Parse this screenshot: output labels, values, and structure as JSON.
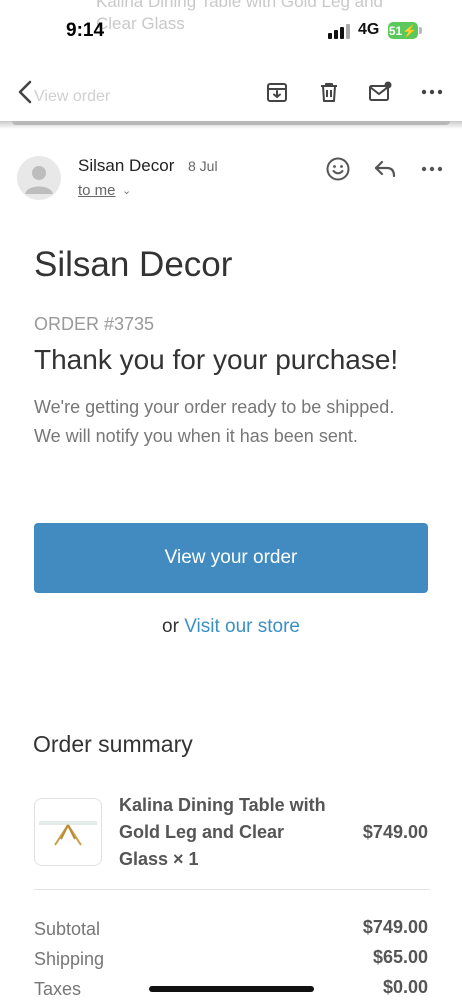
{
  "status_bar": {
    "time": "9:14",
    "network": "4G",
    "battery": "51"
  },
  "background_subject": {
    "line1": "Kalina Dining Table with Gold Leg and",
    "line2": "Clear Glass"
  },
  "toolbar": {
    "ghost_title": "View order"
  },
  "email": {
    "sender": "Silsan Decor",
    "date": "8 Jul",
    "recipient": "to me"
  },
  "body": {
    "brand": "Silsan Decor",
    "order_number": "ORDER #3735",
    "heading": "Thank you for your purchase!",
    "message": "We're getting your order ready to be shipped. We will notify you when it has been sent.",
    "cta_label": "View your order",
    "or_text": "or ",
    "store_link": "Visit our store"
  },
  "order_summary": {
    "title": "Order summary",
    "items": [
      {
        "name": "Kalina Dining Table with Gold Leg and Clear Glass × 1",
        "price": "$749.00"
      }
    ],
    "totals": [
      {
        "label": "Subtotal",
        "value": "$749.00"
      },
      {
        "label": "Shipping",
        "value": "$65.00"
      },
      {
        "label": "Taxes",
        "value": "$0.00"
      }
    ]
  },
  "colors": {
    "accent": "#418bc0",
    "link": "#3a8fc6",
    "battery": "#5ac85a"
  }
}
